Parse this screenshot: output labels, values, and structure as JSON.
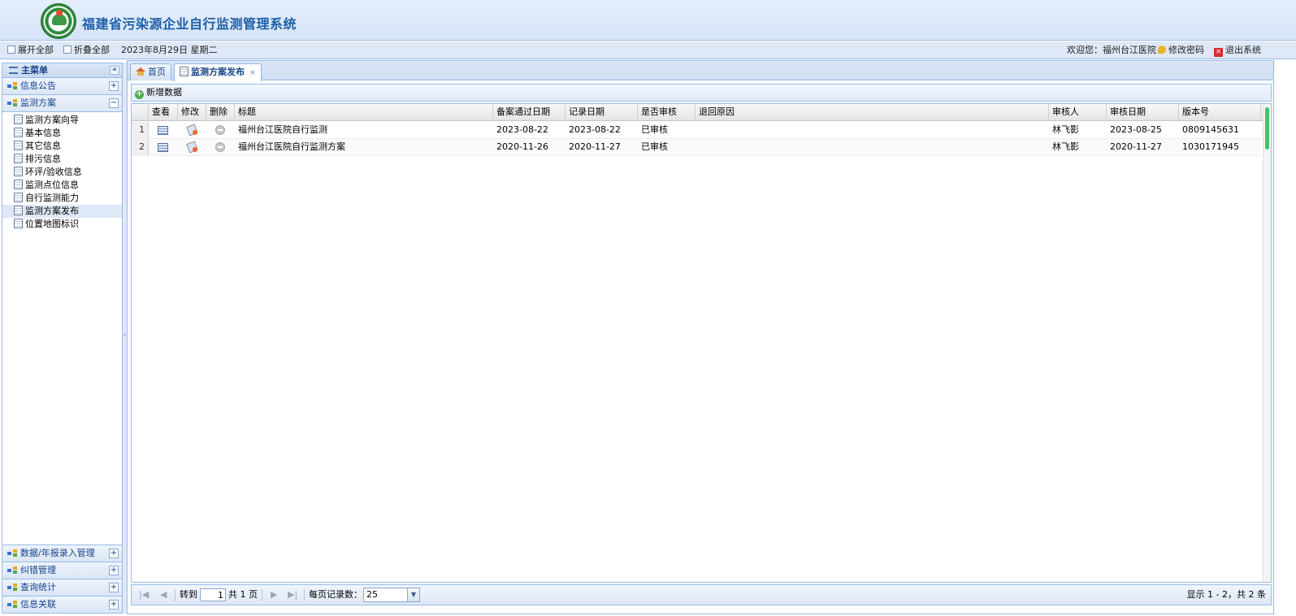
{
  "header": {
    "title": "福建省污染源企业自行监测管理系统"
  },
  "topbar": {
    "expand_all": "展开全部",
    "collapse_all": "折叠全部",
    "date": "2023年8月29日 星期二",
    "welcome": "欢迎您：福州台江医院",
    "change_password": "修改密码",
    "logout": "退出系统"
  },
  "sidebar": {
    "title": "主菜单",
    "sections": [
      {
        "label": "信息公告",
        "toggle": "+"
      },
      {
        "label": "监测方案",
        "toggle": "−"
      }
    ],
    "items": [
      {
        "label": "监测方案向导"
      },
      {
        "label": "基本信息"
      },
      {
        "label": "其它信息"
      },
      {
        "label": "排污信息"
      },
      {
        "label": "环评/验收信息"
      },
      {
        "label": "监测点位信息"
      },
      {
        "label": "自行监测能力"
      },
      {
        "label": "监测方案发布"
      },
      {
        "label": "位置地图标识"
      }
    ],
    "bottom_sections": [
      {
        "label": "数据/年报录入管理",
        "toggle": "+"
      },
      {
        "label": "纠错管理",
        "toggle": "+"
      },
      {
        "label": "查询统计",
        "toggle": "+"
      },
      {
        "label": "信息关联",
        "toggle": "+"
      }
    ]
  },
  "tabs": [
    {
      "label": "首页"
    },
    {
      "label": "监测方案发布"
    }
  ],
  "toolbar": {
    "add_label": "新增数据"
  },
  "grid": {
    "columns": {
      "view": "查看",
      "edit": "修改",
      "delete": "删除",
      "title": "标题",
      "filing_date": "备案通过日期",
      "record_date": "记录日期",
      "reviewed": "是否审核",
      "return_reason": "退回原因",
      "reviewer": "审核人",
      "review_date": "审核日期",
      "version": "版本号"
    },
    "rows": [
      {
        "num": "1",
        "title": "福州台江医院自行监测",
        "filing_date": "2023-08-22",
        "record_date": "2023-08-22",
        "reviewed": "已审核",
        "return_reason": "",
        "reviewer": "林飞影",
        "review_date": "2023-08-25",
        "version": "0809145631"
      },
      {
        "num": "2",
        "title": "福州台江医院自行监测方案",
        "filing_date": "2020-11-26",
        "record_date": "2020-11-27",
        "reviewed": "已审核",
        "return_reason": "",
        "reviewer": "林飞影",
        "review_date": "2020-11-27",
        "version": "1030171945"
      }
    ]
  },
  "paging": {
    "goto_label": "转到",
    "page_value": "1",
    "total_pages": "共 1 页",
    "per_page_label": "每页记录数：",
    "per_page_value": "25",
    "summary": "显示 1 - 2，共 2 条"
  }
}
